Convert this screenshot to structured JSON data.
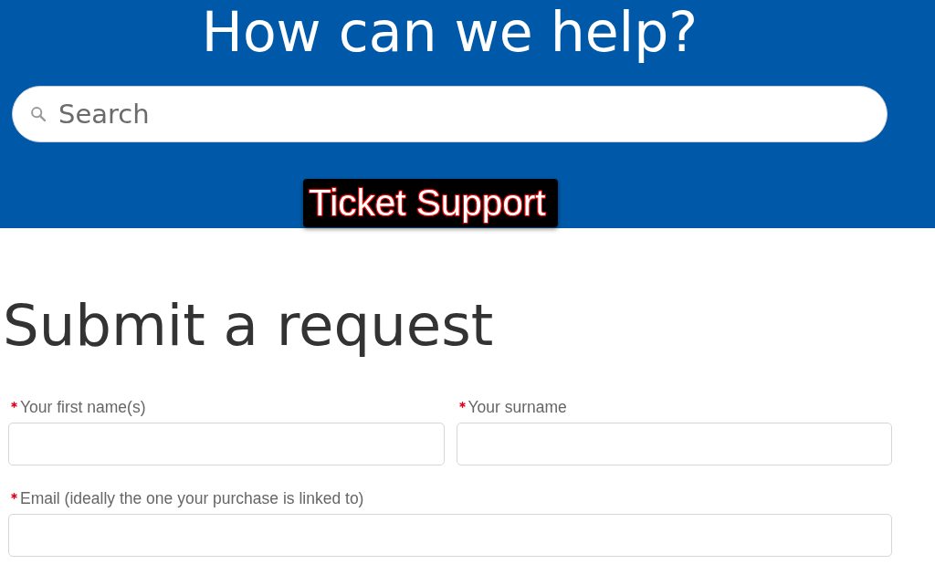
{
  "hero": {
    "heading": "How can we help?",
    "search": {
      "placeholder": "Search"
    }
  },
  "overlay_badge": {
    "text": "Ticket Support"
  },
  "page_title": "Submit a request",
  "form": {
    "rows": [
      {
        "fields": [
          {
            "label": "Your first name(s)",
            "required": true
          },
          {
            "label": "Your surname",
            "required": true
          }
        ]
      },
      {
        "fields": [
          {
            "label": "Email (ideally the one your purchase is linked to)",
            "required": true
          }
        ]
      }
    ]
  }
}
